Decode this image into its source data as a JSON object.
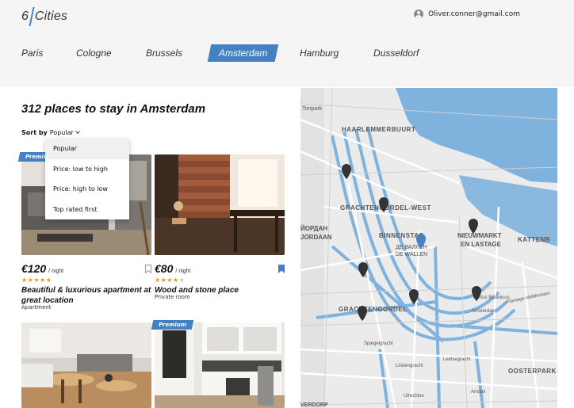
{
  "header": {
    "logo_number": "6",
    "logo_text": "Cities",
    "user_email": "Oliver.conner@gmail.com"
  },
  "tabs": [
    {
      "label": "Paris",
      "active": false
    },
    {
      "label": "Cologne",
      "active": false
    },
    {
      "label": "Brussels",
      "active": false
    },
    {
      "label": "Amsterdam",
      "active": true
    },
    {
      "label": "Hamburg",
      "active": false
    },
    {
      "label": "Dusseldorf",
      "active": false
    }
  ],
  "main": {
    "title": "312 places to stay in Amsterdam",
    "sort_label": "Sort by",
    "sort_value": "Popular",
    "sort_options": [
      "Popular",
      "Price: low to high",
      "Price: high to low",
      "Top rated first"
    ]
  },
  "cards": [
    {
      "premium": "Premium",
      "price": "€120",
      "per": "/ night",
      "rating": 5,
      "name": "Beautiful & luxurious apartment at great location",
      "type": "Apartment",
      "bookmarked": false
    },
    {
      "premium": "",
      "price": "€80",
      "per": "/ night",
      "rating": 4,
      "name": "Wood and stone place",
      "type": "Private room",
      "bookmarked": true
    },
    {
      "premium": "",
      "price": "",
      "per": "",
      "rating": 0,
      "name": "",
      "type": "",
      "bookmarked": false
    },
    {
      "premium": "Premium",
      "price": "",
      "per": "",
      "rating": 0,
      "name": "",
      "type": "",
      "bookmarked": false
    }
  ],
  "map": {
    "labels": [
      "Tierpark",
      "HAARLEMMERBUURT",
      "GRACHTENGORDEL-WEST",
      "ЙОРДАН",
      "JORDAAN",
      "BINNENSTAD",
      "ДЕ ВАЛЛЕН",
      "DE WALLEN",
      "NIEUWMARKT",
      "EN LASTAGE",
      "KATTENB",
      "GRACHTENGORDEL",
      "Hortus Botanicus",
      "Amsterdam",
      "Spiegelgracht",
      "Lindengracht",
      "Plantage Middenlaan",
      "OOSTERPARK",
      "Leidsegracht",
      "Utrechtse",
      "Amstel",
      "VERDORP"
    ],
    "pins": 7,
    "colors": {
      "water": "#7fb2dd",
      "land": "#ebebeb",
      "road": "#ffffff",
      "pin": "#333333",
      "pin_active": "#4481c3"
    }
  },
  "colors": {
    "accent": "#4481c3",
    "star": "#ff9000",
    "header_bg": "#f5f5f5"
  }
}
